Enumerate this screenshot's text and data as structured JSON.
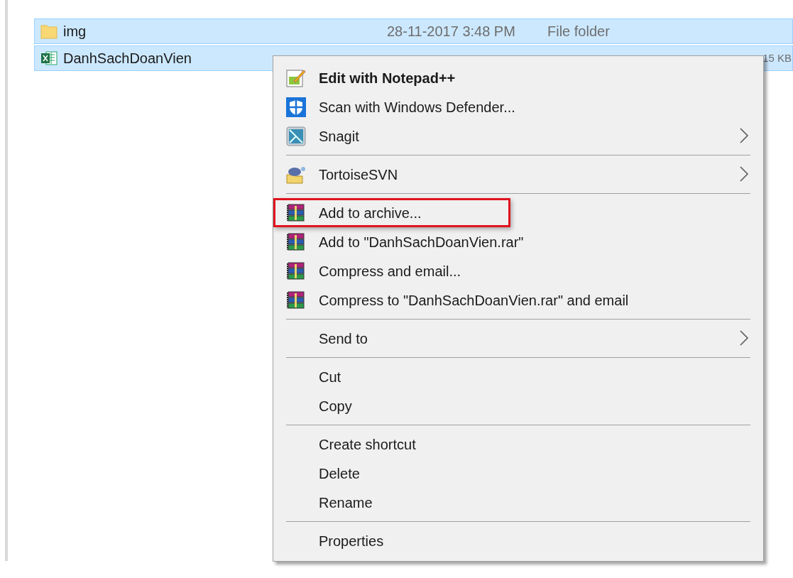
{
  "files": [
    {
      "name": "img",
      "kind": "folder",
      "date": "28-11-2017 3:48 PM",
      "type": "File folder",
      "selected": true
    },
    {
      "name": "DanhSachDoanVien",
      "kind": "spreadsheet",
      "size": "15 KB",
      "selected": true
    }
  ],
  "context_menu": {
    "groups": [
      [
        {
          "label": "Edit with Notepad++",
          "kind": "notepad",
          "bold": true,
          "submenu": false,
          "marked": false
        },
        {
          "label": "Scan with Windows Defender...",
          "kind": "shield",
          "bold": false,
          "submenu": false,
          "marked": false
        },
        {
          "label": "Snagit",
          "kind": "snagit",
          "bold": false,
          "submenu": true,
          "marked": false
        }
      ],
      [
        {
          "label": "TortoiseSVN",
          "kind": "tortoise",
          "bold": false,
          "submenu": true,
          "marked": false
        }
      ],
      [
        {
          "label": "Add to archive...",
          "kind": "archive",
          "bold": false,
          "submenu": false,
          "marked": true
        },
        {
          "label": "Add to \"DanhSachDoanVien.rar\"",
          "kind": "archive",
          "bold": false,
          "submenu": false,
          "marked": false
        },
        {
          "label": "Compress and email...",
          "kind": "archive",
          "bold": false,
          "submenu": false,
          "marked": false
        },
        {
          "label": "Compress to \"DanhSachDoanVien.rar\" and email",
          "kind": "archive",
          "bold": false,
          "submenu": false,
          "marked": false
        }
      ],
      [
        {
          "label": "Send to",
          "kind": "plain",
          "bold": false,
          "submenu": true,
          "marked": false
        }
      ],
      [
        {
          "label": "Cut",
          "kind": "plain",
          "bold": false,
          "submenu": false,
          "marked": false
        },
        {
          "label": "Copy",
          "kind": "plain",
          "bold": false,
          "submenu": false,
          "marked": false
        }
      ],
      [
        {
          "label": "Create shortcut",
          "kind": "plain",
          "bold": false,
          "submenu": false,
          "marked": false
        },
        {
          "label": "Delete",
          "kind": "plain",
          "bold": false,
          "submenu": false,
          "marked": false
        },
        {
          "label": "Rename",
          "kind": "plain",
          "bold": false,
          "submenu": false,
          "marked": false
        }
      ],
      [
        {
          "label": "Properties",
          "kind": "plain",
          "bold": false,
          "submenu": false,
          "marked": false
        }
      ]
    ]
  }
}
